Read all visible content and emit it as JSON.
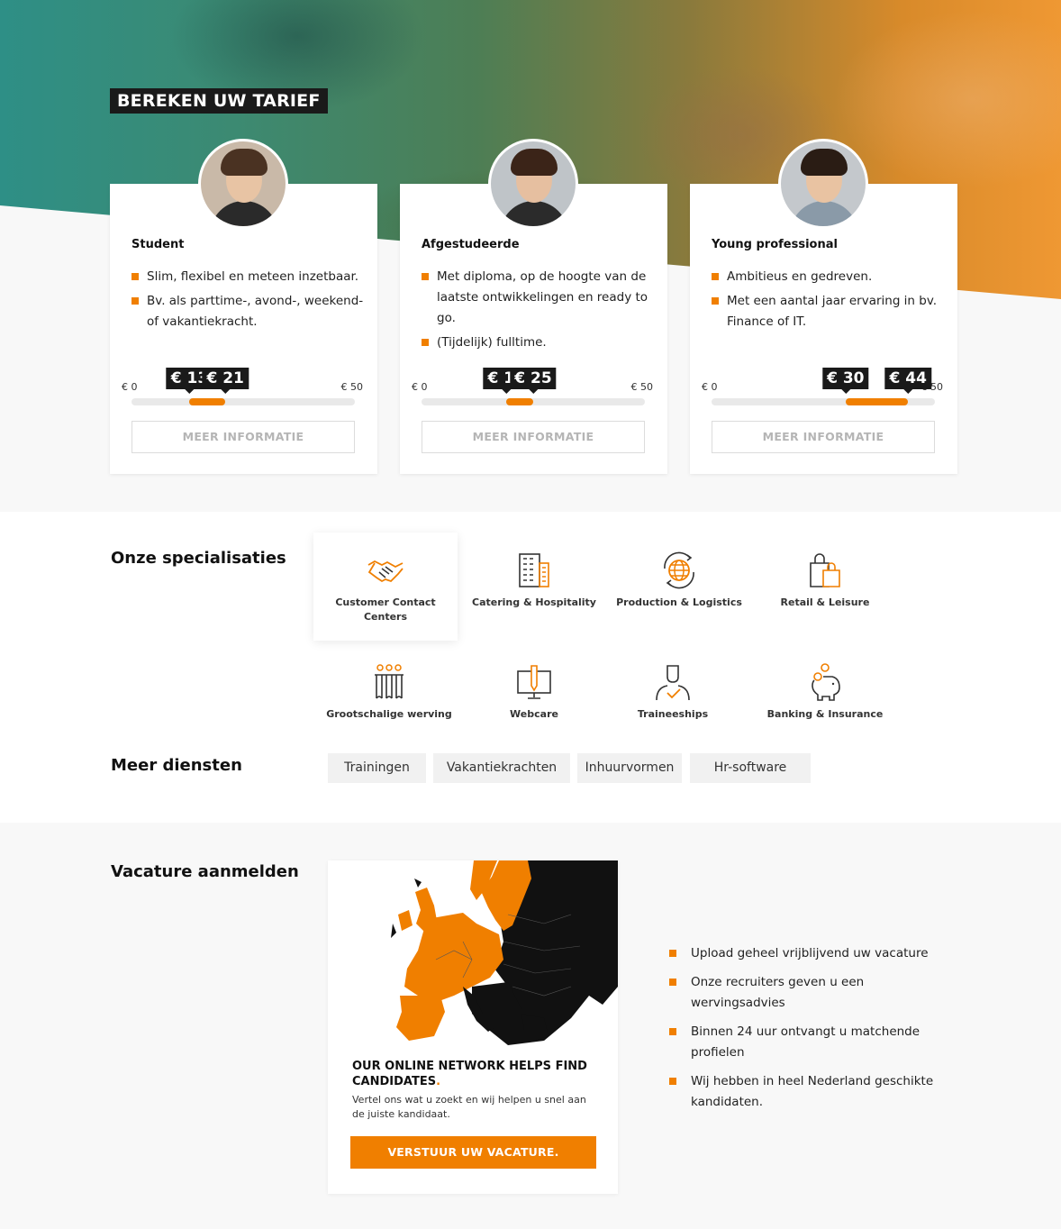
{
  "hero": {
    "title": "BEREKEN UW TARIEF"
  },
  "tariff_cards": [
    {
      "title": "Student",
      "bullets": [
        "Slim, flexibel en meteen inzetbaar.",
        "Bv. als parttime-, avond-, weekend- of vakantiekracht."
      ],
      "range_min_label": "€ 0",
      "range_max_label": "€ 50",
      "range_max": 50,
      "price_low": 13,
      "price_high": 21,
      "price_low_label": "€ 13",
      "price_high_label": "€ 21",
      "button": "MEER INFORMATIE"
    },
    {
      "title": "Afgestudeerde",
      "bullets": [
        "Met diploma, op de hoogte van de laatste ontwikkelingen en ready to go.",
        "(Tijdelijk) fulltime."
      ],
      "range_min_label": "€ 0",
      "range_max_label": "€ 50",
      "range_max": 50,
      "price_low": 19,
      "price_high": 25,
      "price_low_label": "€ 19",
      "price_high_label": "€ 25",
      "button": "MEER INFORMATIE"
    },
    {
      "title": "Young professional",
      "bullets": [
        "Ambitieus en gedreven.",
        "Met een aantal jaar ervaring in bv. Finance of IT."
      ],
      "range_min_label": "€ 0",
      "range_max_label": "€ 50",
      "range_max": 50,
      "price_low": 30,
      "price_high": 44,
      "price_low_label": "€ 30",
      "price_high_label": "€ 44",
      "button": "MEER INFORMATIE"
    }
  ],
  "specialisaties": {
    "heading": "Onze specialisaties",
    "items": [
      {
        "label": "Customer Contact Centers",
        "icon": "handshake-icon",
        "active": true
      },
      {
        "label": "Catering & Hospitality",
        "icon": "building-icon",
        "active": false
      },
      {
        "label": "Production & Logistics",
        "icon": "globe-icon",
        "active": false
      },
      {
        "label": "Retail & Leisure",
        "icon": "shopping-bags-icon",
        "active": false
      },
      {
        "label": "Grootschalige werving",
        "icon": "group-icon",
        "active": false
      },
      {
        "label": "Webcare",
        "icon": "monitor-pencil-icon",
        "active": false
      },
      {
        "label": "Traineeships",
        "icon": "person-check-icon",
        "active": false
      },
      {
        "label": "Banking & Insurance",
        "icon": "piggy-bank-icon",
        "active": false
      }
    ]
  },
  "meer_diensten": {
    "heading": "Meer diensten",
    "items": [
      "Trainingen",
      "Vakantiekrachten",
      "Inhuurvormen",
      "Hr-software"
    ]
  },
  "vacature": {
    "heading": "Vacature aanmelden",
    "headline": "OUR ONLINE NETWORK HELPS FIND CANDIDATES",
    "headline_dot": ".",
    "subtext": "Vertel ons wat u zoekt en wij helpen u snel aan de juiste kandidaat.",
    "button": "VERSTUUR UW VACATURE.",
    "bullets": [
      "Upload geheel vrijblijvend uw vacature",
      "Onze recruiters geven u een wervingsadvies",
      "Binnen 24 uur ontvangt u matchende profielen",
      "Wij hebben in heel Nederland geschikte kandidaten."
    ]
  },
  "colors": {
    "accent": "#f07f00",
    "dark": "#1a1a1a",
    "section_bg": "#f8f8f8"
  }
}
